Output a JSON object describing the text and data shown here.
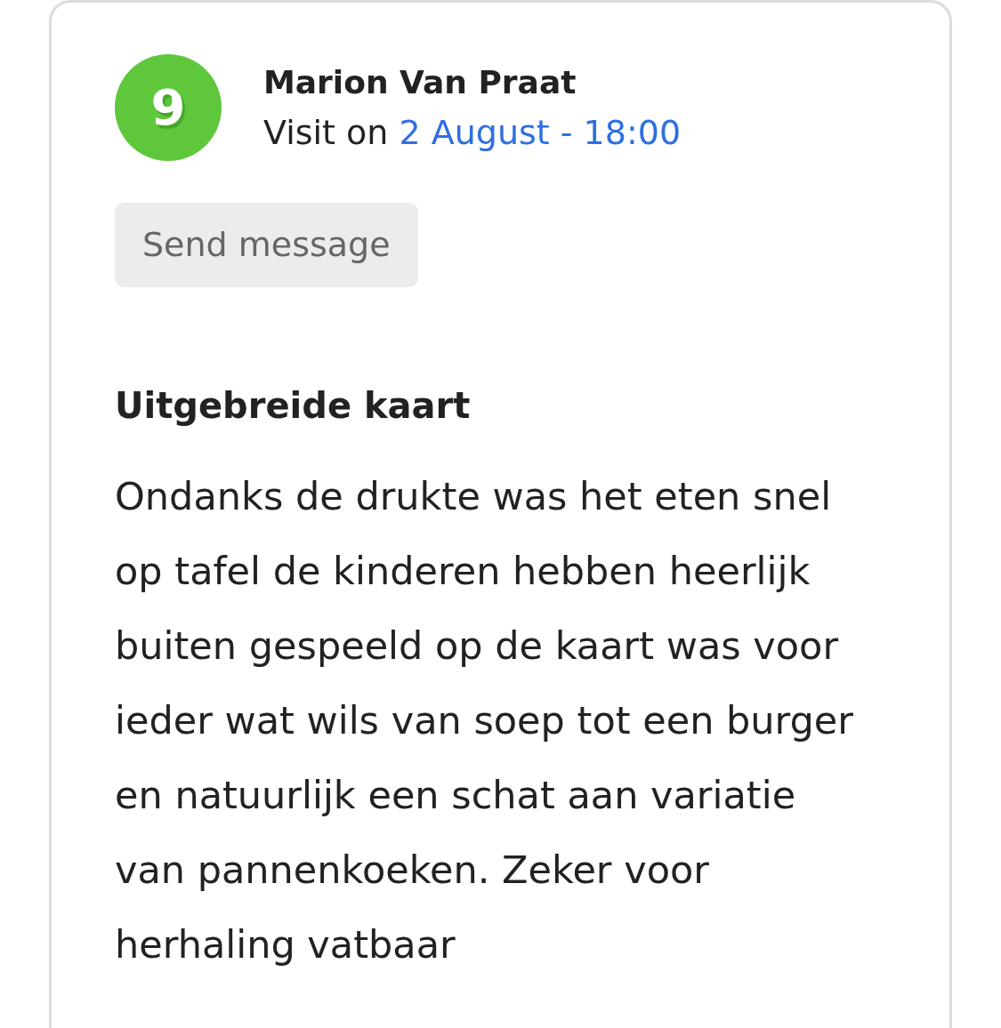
{
  "review": {
    "score": "9",
    "author": "Marion Van Praat",
    "visit_label": "Visit on",
    "visit_date": "2 August - 18:00",
    "action_button": "Send message",
    "heading": "Uitgebreide kaart",
    "body": "Ondanks de drukte was het eten snel op tafel de kinderen hebben heerlijk buiten gespeeld op de kaart was voor ieder wat wils van soep tot een burger en natuurlijk een schat aan variatie van pannenkoeken. Zeker voor herhaling vatbaar"
  }
}
